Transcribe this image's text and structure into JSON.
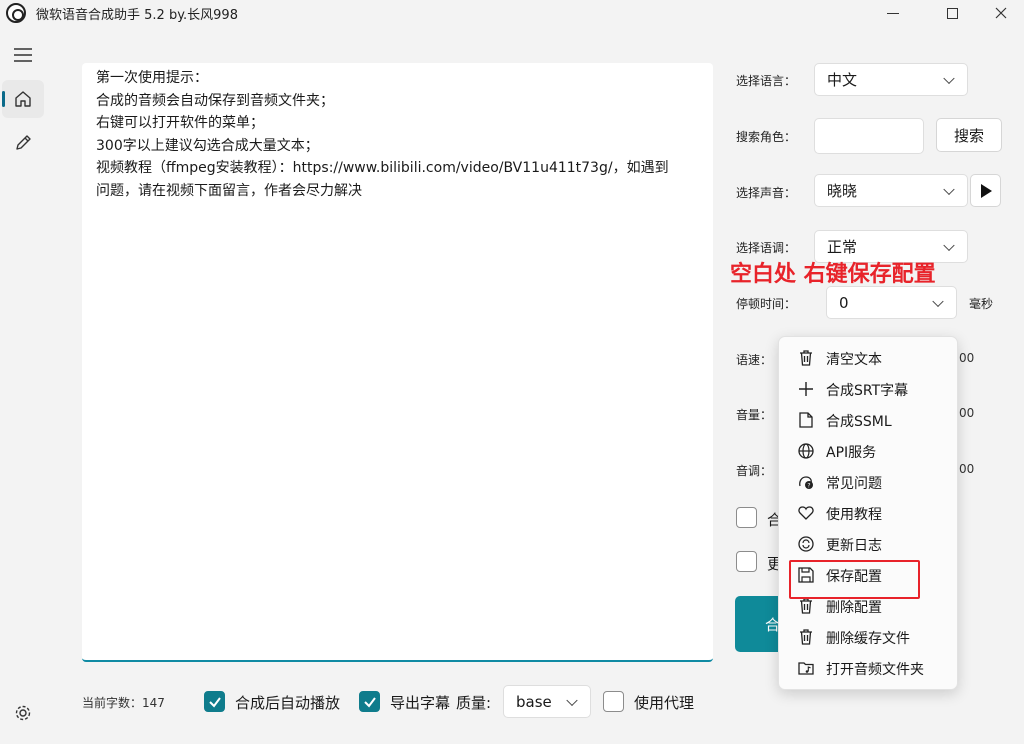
{
  "window": {
    "title": "微软语音合成助手 5.2 by.长风998",
    "minimize_icon": "minimize-icon",
    "maximize_icon": "maximize-icon",
    "close_icon": "close-icon"
  },
  "nav": {
    "items": [
      "menu-icon",
      "home-icon",
      "pencil-icon",
      "settings-icon"
    ]
  },
  "editor": {
    "lines": [
      "第一次使用提示：",
      "合成的音频会自动保存到音频文件夹；",
      "右键可以打开软件的菜单；",
      "300字以上建议勾选合成大量文本；",
      "视频教程（ffmpeg安装教程）：https://www.bilibili.com/video/BV11u411t73g/，如遇到",
      "问题，请在视频下面留言，作者会尽力解决"
    ]
  },
  "bottom": {
    "char_count_label": "当前字数：147",
    "autoplay_label": "合成后自动播放",
    "autoplay_checked": true,
    "export_sub_label": "导出字幕",
    "export_sub_checked": true,
    "quality_label": "质量:",
    "quality_value": "base",
    "proxy_label": "使用代理",
    "proxy_checked": false
  },
  "panel": {
    "language_label": "选择语言：",
    "language_value": "中文",
    "search_role_label": "搜索角色：",
    "search_role_value": "",
    "search_button": "搜索",
    "voice_label": "选择声音：",
    "voice_value": "晓晓",
    "tone_label": "选择语调：",
    "tone_value": "正常",
    "note": "空白处  右键保存配置",
    "pause_label": "停顿时间：",
    "pause_value": "0",
    "pause_unit": "毫秒",
    "speed_label": "语速：",
    "volume_label": "音量：",
    "pitch_label": "音调：",
    "partial_value": "00",
    "check1_partial": "合",
    "check2_partial": "更",
    "synth_button_partial": "合"
  },
  "context_menu": {
    "items": [
      {
        "label": "清空文本",
        "icon": "trash-icon"
      },
      {
        "label": "合成SRT字幕",
        "icon": "plus-icon"
      },
      {
        "label": "合成SSML",
        "icon": "document-icon"
      },
      {
        "label": "API服务",
        "icon": "globe-icon"
      },
      {
        "label": "常见问题",
        "icon": "question-icon"
      },
      {
        "label": "使用教程",
        "icon": "heart-icon"
      },
      {
        "label": "更新日志",
        "icon": "refresh-icon"
      },
      {
        "label": "保存配置",
        "icon": "save-icon"
      },
      {
        "label": "删除配置",
        "icon": "trash-icon"
      },
      {
        "label": "删除缓存文件",
        "icon": "trash-icon"
      },
      {
        "label": "打开音频文件夹",
        "icon": "folder-music-icon"
      }
    ],
    "highlight_color": "#e8232a"
  }
}
